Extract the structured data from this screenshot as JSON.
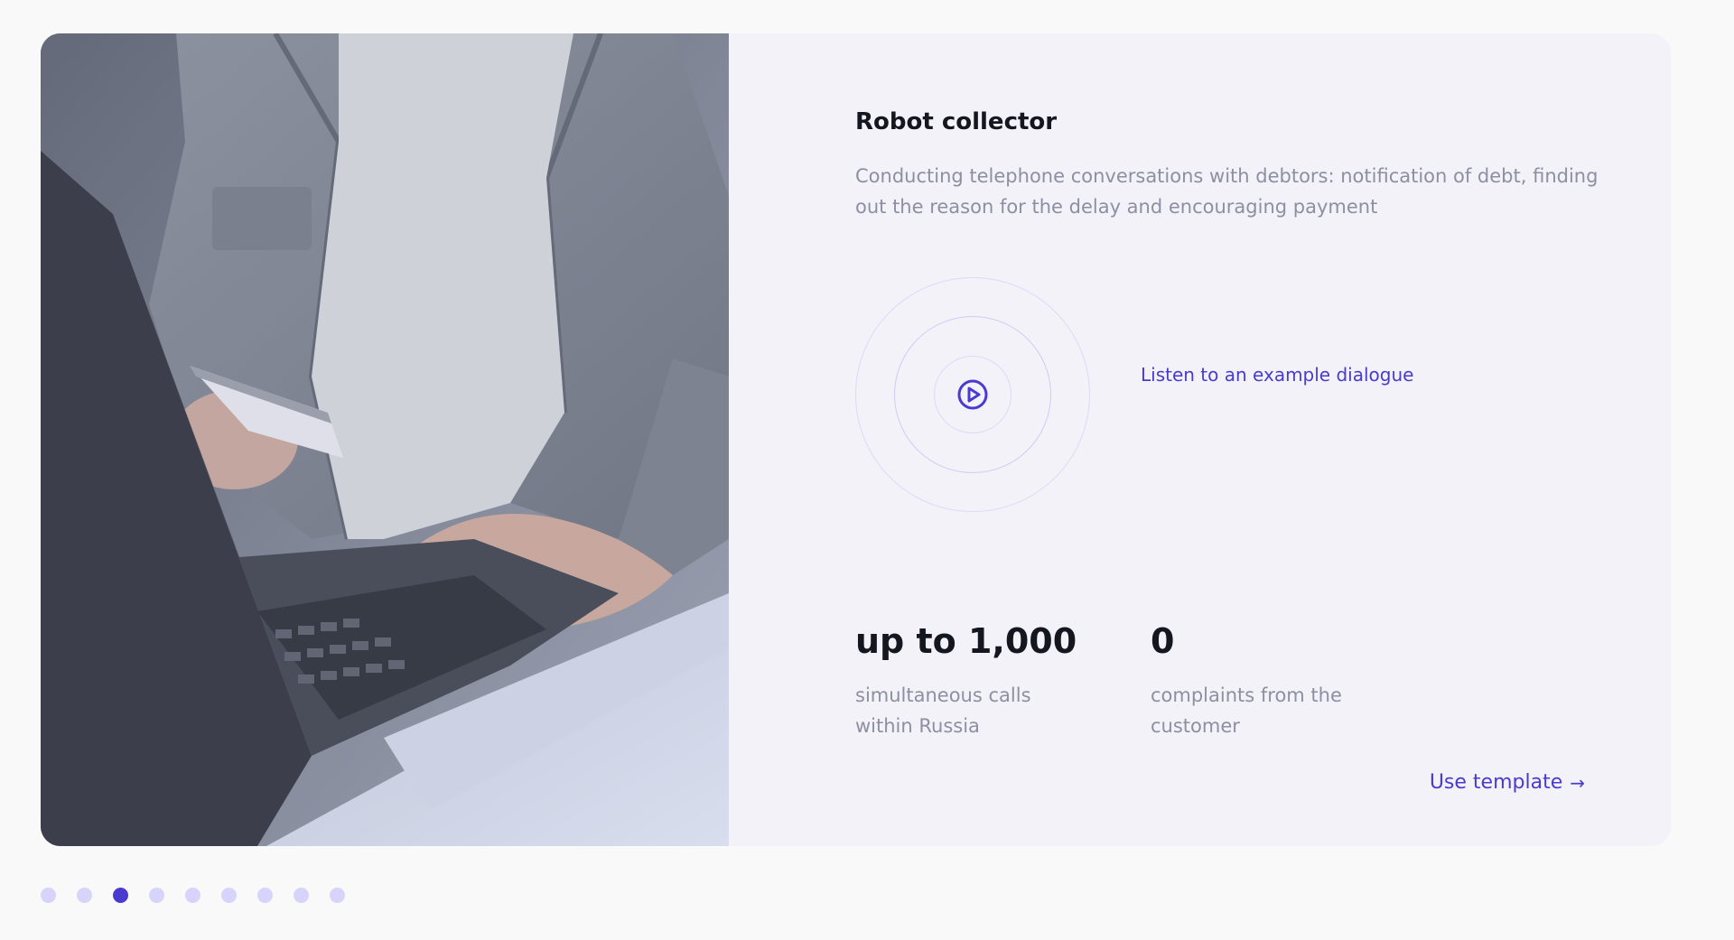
{
  "slide": {
    "title": "Robot collector",
    "description": "Conducting telephone conversations with debtors: notification of debt, finding out the reason for the delay and encouraging payment",
    "listen_link": "Listen to an example dialogue",
    "stats": [
      {
        "value": "up to 1,000",
        "label": "simultaneous calls within Russia"
      },
      {
        "value": "0",
        "label": "complaints from the customer"
      }
    ],
    "cta_label": "Use template",
    "cta_icon": "arrow-right-icon",
    "play_icon": "play-circle-icon"
  },
  "pagination": {
    "total": 9,
    "active_index": 2
  },
  "colors": {
    "accent": "#4a3bd0",
    "card_bg": "#f2f2f8",
    "page_bg": "#f9f9fa",
    "dot_inactive": "#d6d4fa",
    "muted_text": "#8d8fa2",
    "heading_text": "#141620"
  }
}
